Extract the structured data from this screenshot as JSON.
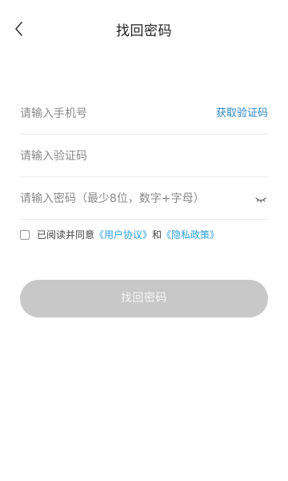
{
  "header": {
    "title": "找回密码"
  },
  "form": {
    "phone": {
      "placeholder": "请输入手机号",
      "value": ""
    },
    "get_code_label": "获取验证码",
    "code": {
      "placeholder": "请输入验证码",
      "value": ""
    },
    "password": {
      "placeholder": "请输入密码（最少8位，数字+字母）",
      "value": ""
    }
  },
  "agreement": {
    "checked": false,
    "prefix": "已阅读并同意",
    "user_agreement": "《用户协议》",
    "and": "和",
    "privacy_policy": "《隐私政策》"
  },
  "submit": {
    "label": "找回密码"
  },
  "colors": {
    "link": "#2aa0d8",
    "button_disabled": "#c8c8c8"
  },
  "icons": {
    "back": "chevron-left-icon",
    "password_visibility": "eye-closed-icon"
  }
}
